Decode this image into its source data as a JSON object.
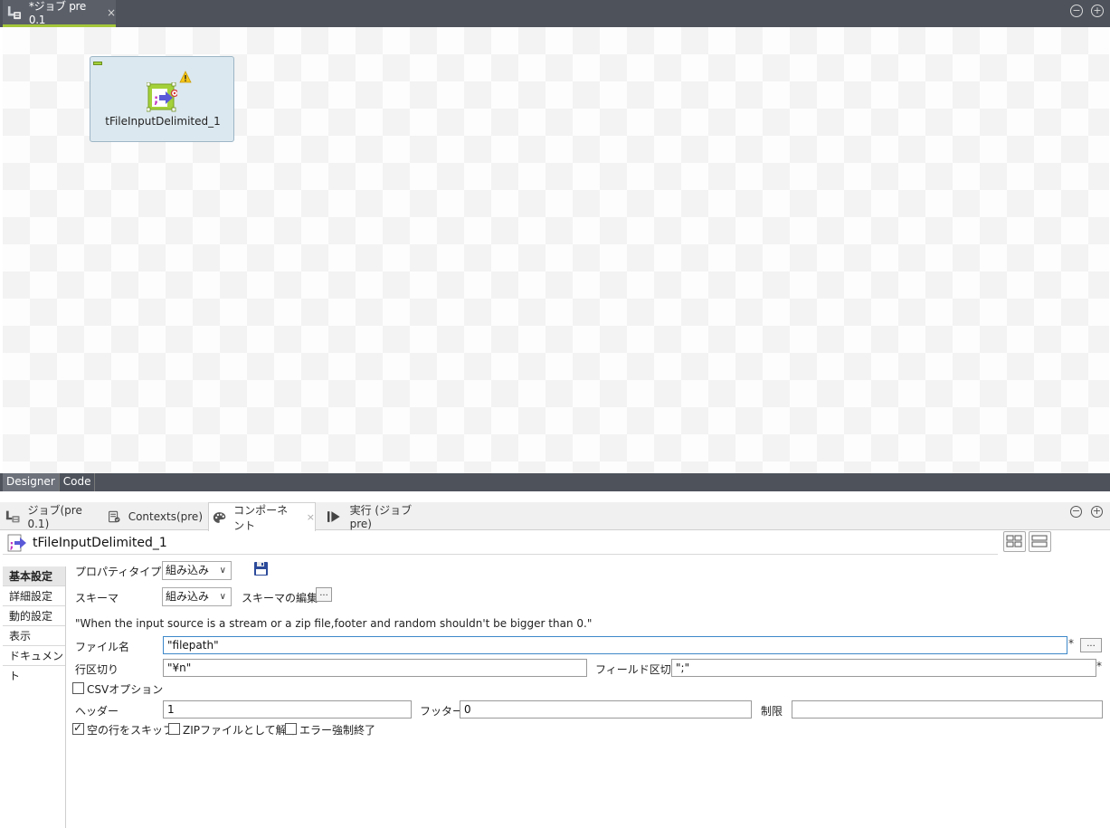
{
  "editor": {
    "tab_label": "*ジョブ pre 0.1",
    "tab_close": "×",
    "minimize": "−",
    "maximize": "+",
    "node_label": "tFileInputDelimited_1",
    "view_tabs": [
      "Designer",
      "Code"
    ]
  },
  "panel": {
    "tabs": [
      {
        "label": "ジョブ(pre 0.1)",
        "icon": "job-icon"
      },
      {
        "label": "Contexts(pre)",
        "icon": "contexts-icon"
      },
      {
        "label": "コンポーネント",
        "icon": "palette-icon"
      },
      {
        "label": "実行 (ジョブ pre)",
        "icon": "run-icon"
      }
    ],
    "active_tab_close": "×",
    "minimize": "−",
    "maximize": "+",
    "component_title": "tFileInputDelimited_1"
  },
  "side_nav": [
    "基本設定",
    "詳細設定",
    "動的設定",
    "表示",
    "ドキュメント"
  ],
  "form": {
    "property_type_label": "プロパティタイプ",
    "property_type_value": "組み込み",
    "schema_label": "スキーマ",
    "schema_value": "組み込み",
    "edit_schema_label": "スキーマの編集",
    "ellipsis": "...",
    "caret": "∨",
    "warning": "\"When the input source is a stream or a zip file,footer and random shouldn't be bigger than 0.\"",
    "filename_label": "ファイル名",
    "filename_value": "\"filepath\"",
    "required": "*",
    "row_sep_label": "行区切り",
    "row_sep_value": "\"¥n\"",
    "field_sep_label": "フィールド区切り",
    "field_sep_value": "\";\"",
    "csv_option_label": "CSVオプション",
    "header_label": "ヘッダー",
    "header_value": "1",
    "footer_label": "フッター",
    "footer_value": "0",
    "limit_label": "制限",
    "limit_value": "",
    "skip_empty_label": "空の行をスキップ",
    "unzip_label": "ZIPファイルとして解凍",
    "die_on_error_label": "エラー強制終了",
    "skip_empty_checked": true,
    "unzip_checked": false,
    "die_on_error_checked": false,
    "csv_option_checked": false
  }
}
